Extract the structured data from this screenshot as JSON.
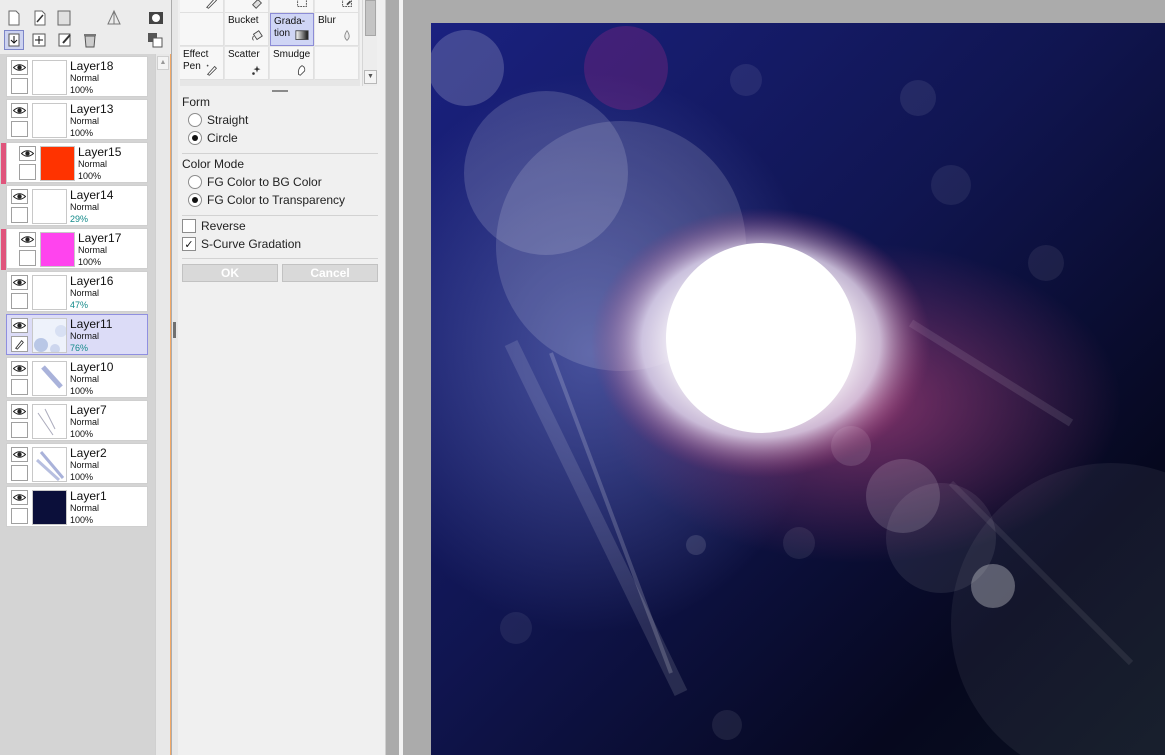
{
  "layer_panel": {
    "toolbar_icons": [
      "new-raster-layer-icon",
      "new-linework-layer-icon",
      "new-layer-folder-icon",
      "perspective-icon",
      "layer-mask-icon",
      "transfer-down-icon",
      "merge-down-icon",
      "clear-layer-icon",
      "delete-layer-icon",
      "merge-visible-icon"
    ],
    "layers": [
      {
        "name": "Layer18",
        "mode": "Normal",
        "opacity": "100%",
        "thumb_color": "#ffffff",
        "clipped": false,
        "selected": false
      },
      {
        "name": "Layer13",
        "mode": "Normal",
        "opacity": "100%",
        "thumb_color": "#ffffff",
        "clipped": false,
        "selected": false
      },
      {
        "name": "Layer15",
        "mode": "Normal",
        "opacity": "100%",
        "thumb_color": "#ff3300",
        "clipped": true,
        "selected": false
      },
      {
        "name": "Layer14",
        "mode": "Normal",
        "opacity": "29%",
        "thumb_color": "#ffffff",
        "clipped": false,
        "selected": false
      },
      {
        "name": "Layer17",
        "mode": "Normal",
        "opacity": "100%",
        "thumb_color": "#ff44ee",
        "clipped": true,
        "selected": false
      },
      {
        "name": "Layer16",
        "mode": "Normal",
        "opacity": "47%",
        "thumb_color": "#ffffff",
        "clipped": false,
        "selected": false
      },
      {
        "name": "Layer11",
        "mode": "Normal",
        "opacity": "76%",
        "thumb_color": "#eef2fb",
        "clipped": false,
        "selected": true
      },
      {
        "name": "Layer10",
        "mode": "Normal",
        "opacity": "100%",
        "thumb_color": "#ffffff",
        "clipped": false,
        "selected": false
      },
      {
        "name": "Layer7",
        "mode": "Normal",
        "opacity": "100%",
        "thumb_color": "#ffffff",
        "clipped": false,
        "selected": false
      },
      {
        "name": "Layer2",
        "mode": "Normal",
        "opacity": "100%",
        "thumb_color": "#ffffff",
        "clipped": false,
        "selected": false
      },
      {
        "name": "Layer1",
        "mode": "Normal",
        "opacity": "100%",
        "thumb_color": "#0b0f3a",
        "clipped": false,
        "selected": false
      }
    ]
  },
  "tool_palette": {
    "row1": [
      {
        "label": "",
        "icon": "pencil-icon"
      },
      {
        "label": "",
        "icon": "eraser-icon"
      },
      {
        "label": "",
        "icon": "select-icon"
      },
      {
        "label": "",
        "icon": "select-eraser-icon"
      }
    ],
    "row2": [
      {
        "label": "",
        "icon": ""
      },
      {
        "label": "Bucket",
        "icon": "bucket-icon"
      },
      {
        "label": "Grada-\ntion",
        "icon": "gradation-icon",
        "active": true
      },
      {
        "label": "Blur",
        "icon": "blur-drop-icon"
      }
    ],
    "row3": [
      {
        "label": "Effect\nPen",
        "icon": "effect-pen-icon"
      },
      {
        "label": "Scatter",
        "icon": "scatter-icon"
      },
      {
        "label": "Smudge",
        "icon": "smudge-icon"
      },
      {
        "label": "",
        "icon": ""
      }
    ]
  },
  "options": {
    "form_title": "Form",
    "form_straight": "Straight",
    "form_circle": "Circle",
    "form_selected": "Circle",
    "color_mode_title": "Color Mode",
    "color_mode_fg_bg": "FG Color to BG Color",
    "color_mode_fg_transparency": "FG Color to Transparency",
    "color_mode_selected": "FG Color to Transparency",
    "reverse_label": "Reverse",
    "reverse_checked": false,
    "scurve_label": "S-Curve Gradation",
    "scurve_checked": true,
    "ok_label": "OK",
    "cancel_label": "Cancel"
  },
  "canvas": {
    "background_colors": [
      "#141a60",
      "#0a0d3a",
      "#070812"
    ],
    "glow_color": "#ffffff",
    "accent_color": "#a03a6e"
  }
}
